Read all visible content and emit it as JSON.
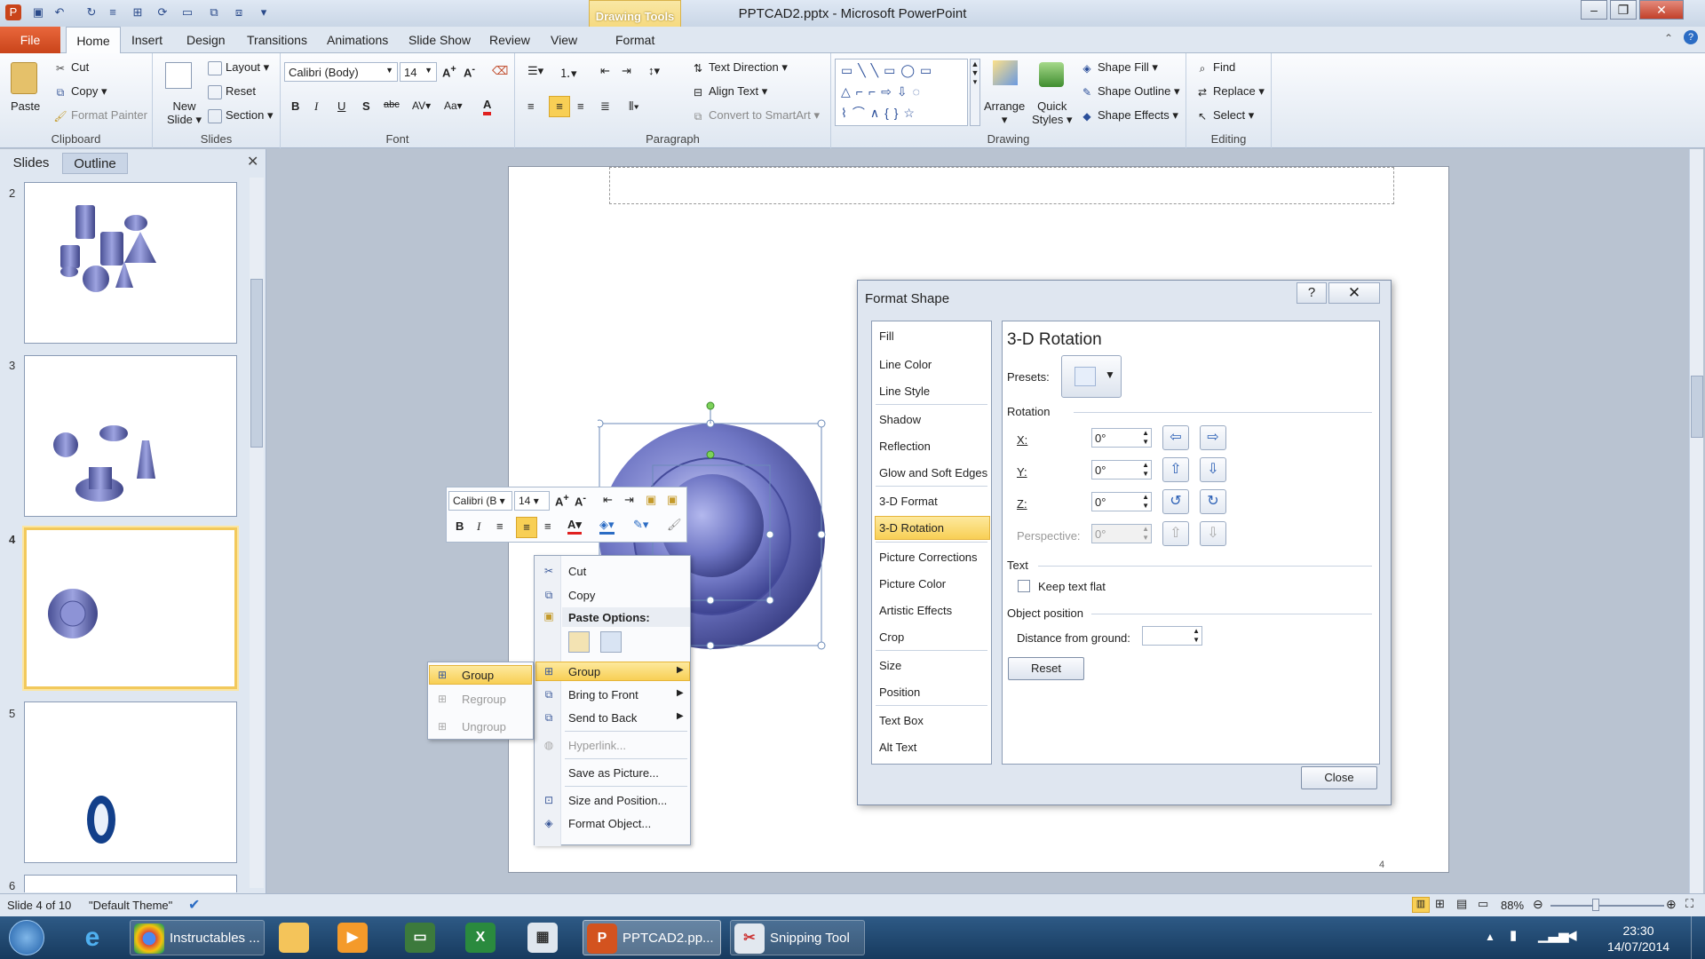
{
  "window": {
    "title": "PPTCAD2.pptx - Microsoft PowerPoint",
    "context_tab_group": "Drawing Tools"
  },
  "tabs": [
    "File",
    "Home",
    "Insert",
    "Design",
    "Transitions",
    "Animations",
    "Slide Show",
    "Review",
    "View",
    "Format"
  ],
  "ribbon": {
    "clipboard": {
      "label": "Clipboard",
      "paste": "Paste",
      "cut": "Cut",
      "copy": "Copy",
      "format_painter": "Format Painter"
    },
    "slides": {
      "label": "Slides",
      "new_slide_1": "New",
      "new_slide_2": "Slide",
      "layout": "Layout",
      "reset": "Reset",
      "section": "Section"
    },
    "font": {
      "label": "Font",
      "font_name": "Calibri (Body)",
      "font_size": "14"
    },
    "paragraph": {
      "label": "Paragraph",
      "text_direction": "Text Direction",
      "align_text": "Align Text",
      "convert_smartart": "Convert to SmartArt"
    },
    "drawing": {
      "label": "Drawing",
      "arrange": "Arrange",
      "quick_styles_1": "Quick",
      "quick_styles_2": "Styles",
      "shape_fill": "Shape Fill",
      "shape_outline": "Shape Outline",
      "shape_effects": "Shape Effects"
    },
    "editing": {
      "label": "Editing",
      "find": "Find",
      "replace": "Replace",
      "select": "Select"
    }
  },
  "panel": {
    "tab_slides": "Slides",
    "tab_outline": "Outline",
    "slide_numbers": [
      "2",
      "3",
      "4",
      "5",
      "6"
    ]
  },
  "slide": {
    "page_number": "4"
  },
  "minibar": {
    "font": "Calibri (B",
    "size": "14"
  },
  "context_menu": {
    "cut": "Cut",
    "copy": "Copy",
    "paste_options": "Paste Options:",
    "group": "Group",
    "bring_front": "Bring to Front",
    "send_back": "Send to Back",
    "hyperlink": "Hyperlink...",
    "save_picture": "Save as Picture...",
    "size_position": "Size and Position...",
    "format_object": "Format Object..."
  },
  "submenu": {
    "group": "Group",
    "regroup": "Regroup",
    "ungroup": "Ungroup"
  },
  "dialog": {
    "title": "Format Shape",
    "nav": [
      "Fill",
      "Line Color",
      "Line Style",
      "Shadow",
      "Reflection",
      "Glow and Soft Edges",
      "3-D Format",
      "3-D Rotation",
      "Picture Corrections",
      "Picture Color",
      "Artistic Effects",
      "Crop",
      "Size",
      "Position",
      "Text Box",
      "Alt Text"
    ],
    "selected": "3-D Rotation",
    "pane_title": "3-D Rotation",
    "presets": "Presets:",
    "rotation": "Rotation",
    "x_label": "X:",
    "y_label": "Y:",
    "z_label": "Z:",
    "perspective": "Perspective:",
    "x": "0°",
    "y": "0°",
    "z": "0°",
    "perspective_value": "0°",
    "text_section": "Text",
    "keep_flat": "Keep text flat",
    "object_position": "Object position",
    "distance": "Distance from ground:",
    "reset": "Reset",
    "close": "Close"
  },
  "status": {
    "slide_info": "Slide 4 of 10",
    "theme": "\"Default Theme\"",
    "zoom": "88%"
  },
  "taskbar": {
    "chrome": "Instructables ...",
    "powerpoint": "PPTCAD2.pp...",
    "snipping": "Snipping Tool",
    "time": "23:30",
    "date": "14/07/2014"
  },
  "colors": {
    "accent": "#f8cf55",
    "file_tab": "#d3531f",
    "shape": "#6f76c4"
  }
}
